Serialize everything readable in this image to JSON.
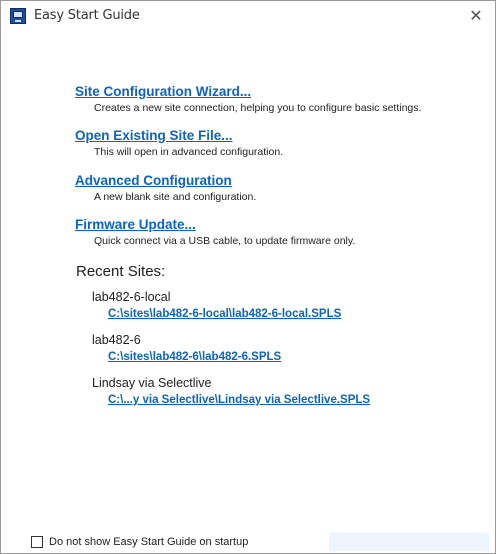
{
  "window": {
    "title": "Easy Start Guide",
    "close_glyph": "✕"
  },
  "options": [
    {
      "label": "Site Configuration Wizard...",
      "description": "Creates a new site connection, helping you to configure basic settings."
    },
    {
      "label": "Open Existing Site File...",
      "description": "This will open in advanced configuration."
    },
    {
      "label": "Advanced Configuration",
      "description": "A new blank site and configuration."
    },
    {
      "label": "Firmware Update...",
      "description": "Quick connect via a USB cable, to update firmware only."
    }
  ],
  "recent": {
    "heading": "Recent Sites:",
    "items": [
      {
        "name": "lab482-6-local",
        "path": "C:\\sites\\lab482-6-local\\lab482-6-local.SPLS"
      },
      {
        "name": "lab482-6",
        "path": "C:\\sites\\lab482-6\\lab482-6.SPLS"
      },
      {
        "name": "Lindsay via Selectlive",
        "path": "C:\\...y via Selectlive\\Lindsay via Selectlive.SPLS"
      }
    ]
  },
  "footer": {
    "checkbox_label": "Do not show Easy Start Guide on startup",
    "checked": false
  },
  "colors": {
    "link": "#0a64c8",
    "text": "#222222",
    "border": "#9a9a9a"
  },
  "icons": {
    "app": "app-monitor-icon",
    "close": "close-icon"
  }
}
